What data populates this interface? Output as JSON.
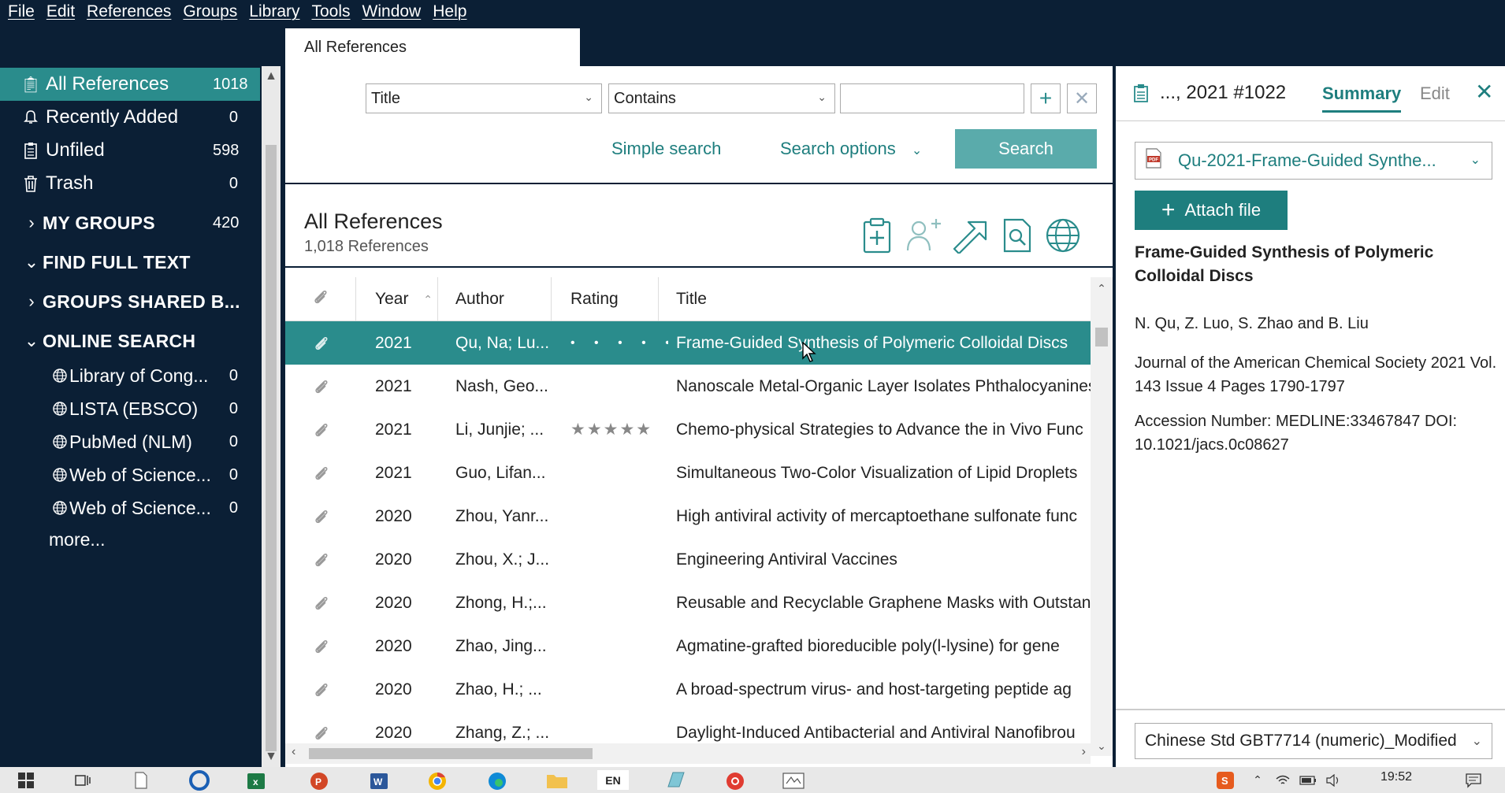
{
  "menu": [
    "File",
    "Edit",
    "References",
    "Groups",
    "Library",
    "Tools",
    "Window",
    "Help"
  ],
  "tab": {
    "label": "All References"
  },
  "sidebar": {
    "items": [
      {
        "label": "All References",
        "count": "1018",
        "icon": "clipboard-icon"
      },
      {
        "label": "Recently Added",
        "count": "0",
        "icon": "bell-icon"
      },
      {
        "label": "Unfiled",
        "count": "598",
        "icon": "clipboard-icon"
      },
      {
        "label": "Trash",
        "count": "0",
        "icon": "trash-icon"
      }
    ],
    "sections": [
      {
        "label": "MY GROUPS",
        "count": "420",
        "expanded": false
      },
      {
        "label": "FIND FULL TEXT",
        "count": "",
        "expanded": true
      },
      {
        "label": "GROUPS SHARED B...",
        "count": "",
        "expanded": false
      },
      {
        "label": "ONLINE SEARCH",
        "count": "",
        "expanded": true
      }
    ],
    "online": [
      {
        "label": "Library of Cong...",
        "count": "0"
      },
      {
        "label": "LISTA (EBSCO)",
        "count": "0"
      },
      {
        "label": "PubMed (NLM)",
        "count": "0"
      },
      {
        "label": "Web of Science...",
        "count": "0"
      },
      {
        "label": "Web of Science...",
        "count": "0"
      }
    ],
    "more": "more..."
  },
  "search": {
    "field": "Title",
    "operator": "Contains",
    "value": "",
    "simple_search": "Simple search",
    "search_options": "Search options",
    "search_button": "Search"
  },
  "list": {
    "title": "All References",
    "count": "1,018 References"
  },
  "table": {
    "headers": {
      "year": "Year",
      "author": "Author",
      "rating": "Rating",
      "title": "Title"
    },
    "rows": [
      {
        "year": "2021",
        "author": "Qu, Na; Lu...",
        "rating": "• • • • •",
        "title": "Frame-Guided Synthesis of Polymeric Colloidal Discs",
        "selected": true
      },
      {
        "year": "2021",
        "author": "Nash, Geo...",
        "rating": "",
        "title": "Nanoscale Metal-Organic Layer Isolates Phthalocyanines"
      },
      {
        "year": "2021",
        "author": "Li, Junjie; ...",
        "rating": "★★★★★",
        "title": "Chemo-physical Strategies to Advance the in Vivo Func"
      },
      {
        "year": "2021",
        "author": "Guo, Lifan...",
        "rating": "",
        "title": "Simultaneous Two-Color Visualization of Lipid Droplets"
      },
      {
        "year": "2020",
        "author": "Zhou, Yanr...",
        "rating": "",
        "title": "High antiviral activity of mercaptoethane sulfonate func"
      },
      {
        "year": "2020",
        "author": "Zhou, X.; J...",
        "rating": "",
        "title": "Engineering Antiviral Vaccines"
      },
      {
        "year": "2020",
        "author": "Zhong, H.;...",
        "rating": "",
        "title": "Reusable and Recyclable Graphene Masks with Outstan"
      },
      {
        "year": "2020",
        "author": "Zhao, Jing...",
        "rating": "",
        "title": "Agmatine-grafted bioreducible poly(l-lysine) for gene"
      },
      {
        "year": "2020",
        "author": "Zhao, H.; ...",
        "rating": "",
        "title": "A broad-spectrum virus- and host-targeting peptide ag"
      },
      {
        "year": "2020",
        "author": "Zhang, Z.; ...",
        "rating": "",
        "title": "Daylight-Induced Antibacterial and Antiviral Nanofibrou"
      }
    ]
  },
  "panel": {
    "ref": "..., 2021 #1022",
    "tab_summary": "Summary",
    "tab_edit": "Edit",
    "file": "Qu-2021-Frame-Guided Synthe...",
    "attach": "Attach file",
    "title": "Frame-Guided Synthesis of Polymeric Colloidal Discs",
    "authors": "N. Qu, Z. Luo, S. Zhao and B. Liu",
    "journal": "Journal of the American Chemical Society 2021 Vol. 143 Issue 4 Pages 1790-1797",
    "accession": "Accession Number: MEDLINE:33467847 DOI: 10.1021/jacs.0c08627",
    "style": "Chinese Std GBT7714 (numeric)_Modified"
  },
  "taskbar": {
    "time": "19:52",
    "lang": "EN"
  },
  "colors": {
    "accent": "#2a8c8c",
    "dark": "#0b1f35",
    "link": "#1e7e7e"
  }
}
